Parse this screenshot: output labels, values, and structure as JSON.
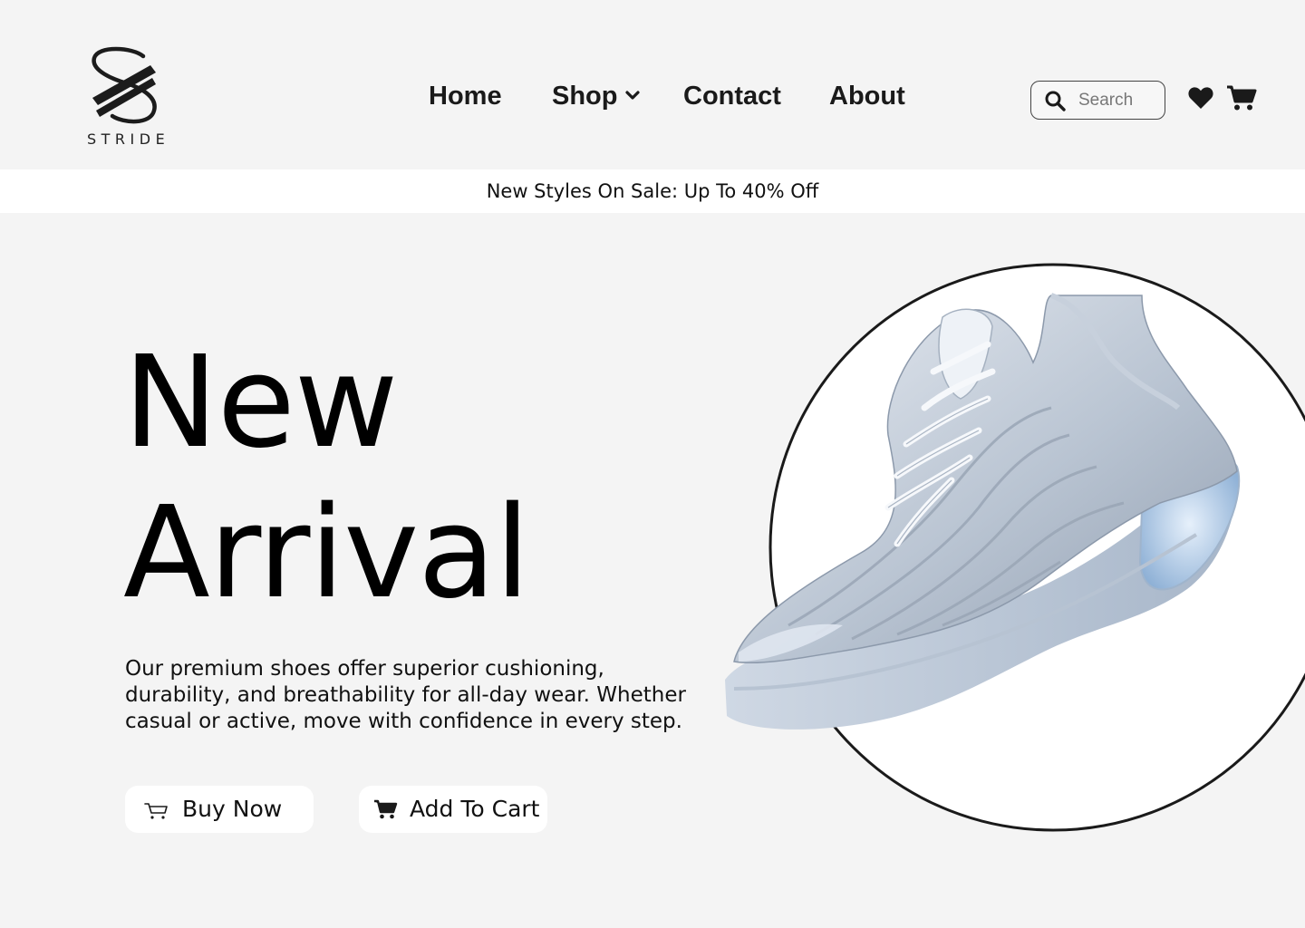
{
  "brand": {
    "name": "STRIDE"
  },
  "nav": {
    "home": "Home",
    "shop": "Shop",
    "contact": "Contact",
    "about": "About"
  },
  "search": {
    "placeholder": "Search"
  },
  "promo": {
    "text": "New Styles On Sale: Up To 40% Off"
  },
  "hero": {
    "title_line1": "New",
    "title_line2": "Arrival",
    "description": "Our premium shoes offer superior cushioning, durability, and breathability for all-day wear. Whether casual or active, move with confidence in every step.",
    "buy_now": "Buy Now",
    "add_to_cart": "Add To Cart"
  },
  "icons": {
    "search": "search-icon",
    "wishlist": "heart-icon",
    "cart": "cart-icon",
    "dropdown": "chevron-down-icon"
  },
  "colors": {
    "background": "#f4f4f4",
    "banner": "#ffffff",
    "text": "#111111",
    "shoe": "#a9b6c8"
  }
}
